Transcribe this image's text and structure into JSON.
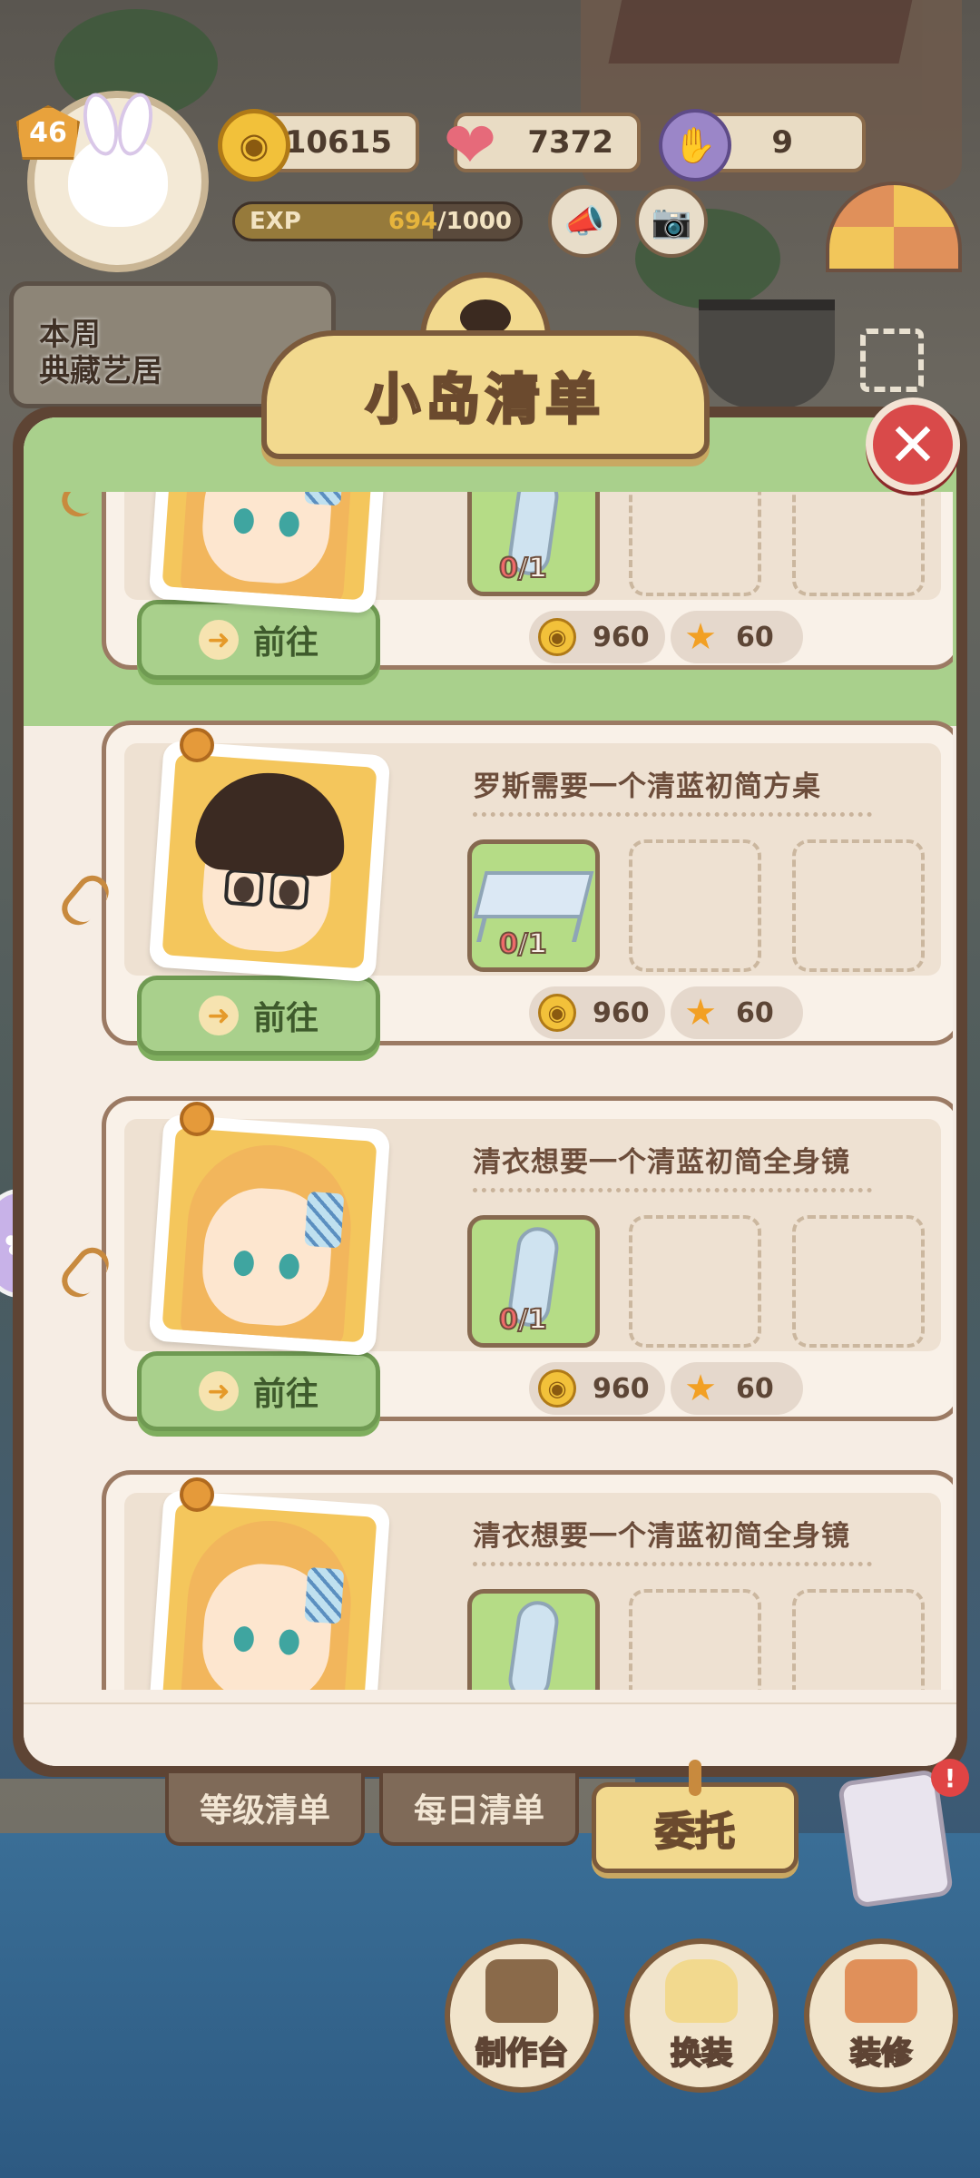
{
  "hud": {
    "level": "46",
    "coins": "10615",
    "hearts": "7372",
    "gloves": "9",
    "exp_label": "EXP",
    "exp_current": "694",
    "exp_max": "/1000",
    "exp_progress": 0.694
  },
  "weekly": {
    "line1": "本周",
    "line2": "典藏艺居"
  },
  "panel": {
    "title": "小岛清单",
    "close_symbol": "✕"
  },
  "cards": [
    {
      "request": "",
      "character": "blonde-girl",
      "item": "mirror",
      "have": "0",
      "need": "/1",
      "go_label": "前往",
      "coin_reward": "960",
      "star_reward": "60"
    },
    {
      "request": "罗斯需要一个清蓝初简方桌",
      "character": "glasses-boy",
      "item": "table",
      "have": "0",
      "need": "/1",
      "go_label": "前往",
      "coin_reward": "960",
      "star_reward": "60"
    },
    {
      "request": "清衣想要一个清蓝初简全身镜",
      "character": "blonde-girl",
      "item": "mirror",
      "have": "0",
      "need": "/1",
      "go_label": "前往",
      "coin_reward": "960",
      "star_reward": "60"
    },
    {
      "request": "清衣想要一个清蓝初简全身镜",
      "character": "blonde-girl",
      "item": "mirror"
    }
  ],
  "tabs": {
    "level_list": "等级清单",
    "daily_list": "每日清单",
    "commission": "委托"
  },
  "actions": {
    "workbench": "制作台",
    "dress_up": "换装",
    "decorate": "装修"
  },
  "notice": "!",
  "colors": {
    "panel_frame": "#5e4434",
    "panel_bg": "#f6ede4",
    "go_button": "#a9d08c",
    "title_plate": "#f2d98e",
    "close_button": "#d94a4a"
  }
}
